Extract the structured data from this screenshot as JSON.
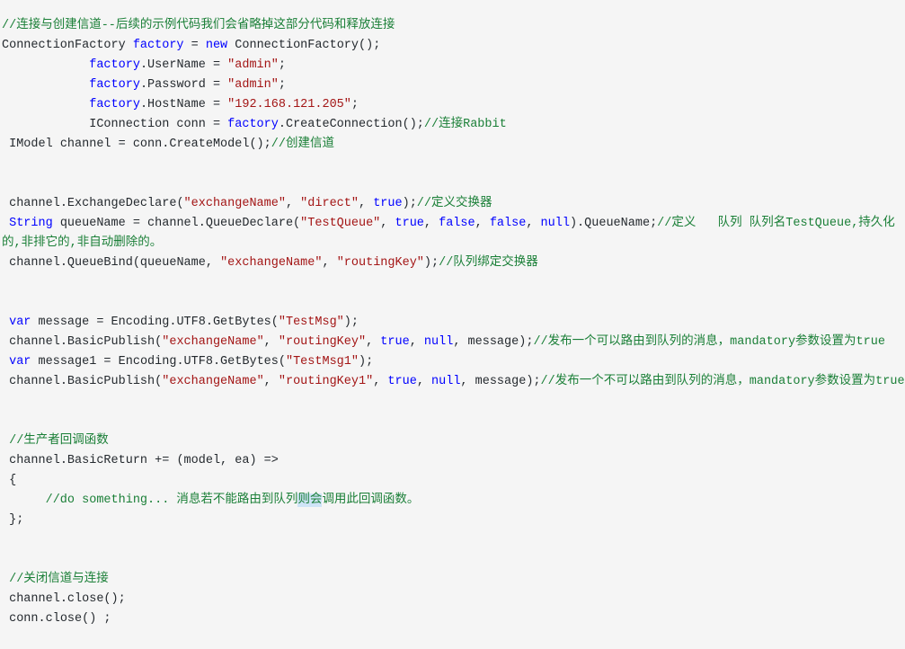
{
  "editor": {
    "background_color": "#f5f5f5",
    "language": "csharp",
    "colors": {
      "plain": "#24292e",
      "keyword": "#0000ff",
      "string": "#a31515",
      "comment": "#1a7f37",
      "selection": "#cfe4f7"
    },
    "selection_text": "则会"
  },
  "lines": [
    {
      "id": "line-1",
      "tokens": [
        {
          "t": "cmt",
          "v": "//连接与创建信道--后续的示例代码我们会省略掉这部分代码和释放连接"
        }
      ]
    },
    {
      "id": "line-2",
      "tokens": [
        {
          "t": "plain",
          "v": "ConnectionFactory "
        },
        {
          "t": "kw",
          "v": "factory"
        },
        {
          "t": "plain",
          "v": " = "
        },
        {
          "t": "kw",
          "v": "new"
        },
        {
          "t": "plain",
          "v": " ConnectionFactory();"
        }
      ]
    },
    {
      "id": "line-3",
      "tokens": [
        {
          "t": "plain",
          "v": "            "
        },
        {
          "t": "kw",
          "v": "factory"
        },
        {
          "t": "plain",
          "v": ".UserName = "
        },
        {
          "t": "str",
          "v": "\"admin\""
        },
        {
          "t": "plain",
          "v": ";"
        }
      ]
    },
    {
      "id": "line-4",
      "tokens": [
        {
          "t": "plain",
          "v": "            "
        },
        {
          "t": "kw",
          "v": "factory"
        },
        {
          "t": "plain",
          "v": ".Password = "
        },
        {
          "t": "str",
          "v": "\"admin\""
        },
        {
          "t": "plain",
          "v": ";"
        }
      ]
    },
    {
      "id": "line-5",
      "tokens": [
        {
          "t": "plain",
          "v": "            "
        },
        {
          "t": "kw",
          "v": "factory"
        },
        {
          "t": "plain",
          "v": ".HostName = "
        },
        {
          "t": "str",
          "v": "\"192.168.121.205\""
        },
        {
          "t": "plain",
          "v": ";"
        }
      ]
    },
    {
      "id": "line-6",
      "tokens": [
        {
          "t": "plain",
          "v": "            IConnection conn = "
        },
        {
          "t": "kw",
          "v": "factory"
        },
        {
          "t": "plain",
          "v": ".CreateConnection();"
        },
        {
          "t": "cmt",
          "v": "//连接Rabbit"
        }
      ]
    },
    {
      "id": "line-7",
      "tokens": [
        {
          "t": "plain",
          "v": " IModel channel = conn.CreateModel();"
        },
        {
          "t": "cmt",
          "v": "//创建信道"
        }
      ]
    },
    {
      "id": "line-8",
      "blank": true
    },
    {
      "id": "line-9",
      "blank": true
    },
    {
      "id": "line-10",
      "tokens": [
        {
          "t": "plain",
          "v": " channel.ExchangeDeclare("
        },
        {
          "t": "str",
          "v": "\"exchangeName\""
        },
        {
          "t": "plain",
          "v": ", "
        },
        {
          "t": "str",
          "v": "\"direct\""
        },
        {
          "t": "plain",
          "v": ", "
        },
        {
          "t": "kw",
          "v": "true"
        },
        {
          "t": "plain",
          "v": ");"
        },
        {
          "t": "cmt",
          "v": "//定义交换器"
        }
      ]
    },
    {
      "id": "line-11",
      "tokens": [
        {
          "t": "plain",
          "v": " "
        },
        {
          "t": "kw",
          "v": "String"
        },
        {
          "t": "plain",
          "v": " queueName = channel.QueueDeclare("
        },
        {
          "t": "str",
          "v": "\"TestQueue\""
        },
        {
          "t": "plain",
          "v": ", "
        },
        {
          "t": "kw",
          "v": "true"
        },
        {
          "t": "plain",
          "v": ", "
        },
        {
          "t": "kw",
          "v": "false"
        },
        {
          "t": "plain",
          "v": ", "
        },
        {
          "t": "kw",
          "v": "false"
        },
        {
          "t": "plain",
          "v": ", "
        },
        {
          "t": "kw",
          "v": "null"
        },
        {
          "t": "plain",
          "v": ").QueueName;"
        },
        {
          "t": "cmt",
          "v": "//定义   队列 队列名TestQueue,持久化的,非排它的,非自动删除的。"
        }
      ]
    },
    {
      "id": "line-12",
      "tokens": [
        {
          "t": "plain",
          "v": " channel.QueueBind(queueName, "
        },
        {
          "t": "str",
          "v": "\"exchangeName\""
        },
        {
          "t": "plain",
          "v": ", "
        },
        {
          "t": "str",
          "v": "\"routingKey\""
        },
        {
          "t": "plain",
          "v": ");"
        },
        {
          "t": "cmt",
          "v": "//队列绑定交换器"
        }
      ]
    },
    {
      "id": "line-13",
      "blank": true
    },
    {
      "id": "line-14",
      "blank": true
    },
    {
      "id": "line-15",
      "tokens": [
        {
          "t": "plain",
          "v": " "
        },
        {
          "t": "kw",
          "v": "var"
        },
        {
          "t": "plain",
          "v": " message = Encoding.UTF8.GetBytes("
        },
        {
          "t": "str",
          "v": "\"TestMsg\""
        },
        {
          "t": "plain",
          "v": ");"
        }
      ]
    },
    {
      "id": "line-16",
      "tokens": [
        {
          "t": "plain",
          "v": " channel.BasicPublish("
        },
        {
          "t": "str",
          "v": "\"exchangeName\""
        },
        {
          "t": "plain",
          "v": ", "
        },
        {
          "t": "str",
          "v": "\"routingKey\""
        },
        {
          "t": "plain",
          "v": ", "
        },
        {
          "t": "kw",
          "v": "true"
        },
        {
          "t": "plain",
          "v": ", "
        },
        {
          "t": "kw",
          "v": "null"
        },
        {
          "t": "plain",
          "v": ", message);"
        },
        {
          "t": "cmt",
          "v": "//发布一个可以路由到队列的消息，mandatory参数设置为true"
        }
      ]
    },
    {
      "id": "line-17",
      "tokens": [
        {
          "t": "plain",
          "v": " "
        },
        {
          "t": "kw",
          "v": "var"
        },
        {
          "t": "plain",
          "v": " message1 = Encoding.UTF8.GetBytes("
        },
        {
          "t": "str",
          "v": "\"TestMsg1\""
        },
        {
          "t": "plain",
          "v": ");"
        }
      ]
    },
    {
      "id": "line-18",
      "tokens": [
        {
          "t": "plain",
          "v": " channel.BasicPublish("
        },
        {
          "t": "str",
          "v": "\"exchangeName\""
        },
        {
          "t": "plain",
          "v": ", "
        },
        {
          "t": "str",
          "v": "\"routingKey1\""
        },
        {
          "t": "plain",
          "v": ", "
        },
        {
          "t": "kw",
          "v": "true"
        },
        {
          "t": "plain",
          "v": ", "
        },
        {
          "t": "kw",
          "v": "null"
        },
        {
          "t": "plain",
          "v": ", message);"
        },
        {
          "t": "cmt",
          "v": "//发布一个不可以路由到队列的消息，mandatory参数设置为true"
        }
      ]
    },
    {
      "id": "line-19",
      "blank": true
    },
    {
      "id": "line-20",
      "blank": true
    },
    {
      "id": "line-21",
      "tokens": [
        {
          "t": "cmt",
          "v": " //生产者回调函数"
        }
      ]
    },
    {
      "id": "line-22",
      "tokens": [
        {
          "t": "plain",
          "v": " channel.BasicReturn += (model, ea) =>"
        }
      ]
    },
    {
      "id": "line-23",
      "tokens": [
        {
          "t": "plain",
          "v": " {"
        }
      ]
    },
    {
      "id": "line-24",
      "tokens": [
        {
          "t": "cmt",
          "v": "      //do something... 消息若不能路由到队列"
        },
        {
          "t": "cmt-sel",
          "v": "则会"
        },
        {
          "t": "cmt",
          "v": "调用此回调函数。"
        }
      ]
    },
    {
      "id": "line-25",
      "tokens": [
        {
          "t": "plain",
          "v": " };"
        }
      ]
    },
    {
      "id": "line-26",
      "blank": true
    },
    {
      "id": "line-27",
      "blank": true
    },
    {
      "id": "line-28",
      "tokens": [
        {
          "t": "cmt",
          "v": " //关闭信道与连接"
        }
      ]
    },
    {
      "id": "line-29",
      "tokens": [
        {
          "t": "plain",
          "v": " channel.close();"
        }
      ]
    },
    {
      "id": "line-30",
      "tokens": [
        {
          "t": "plain",
          "v": " conn.close() ;"
        }
      ]
    }
  ]
}
